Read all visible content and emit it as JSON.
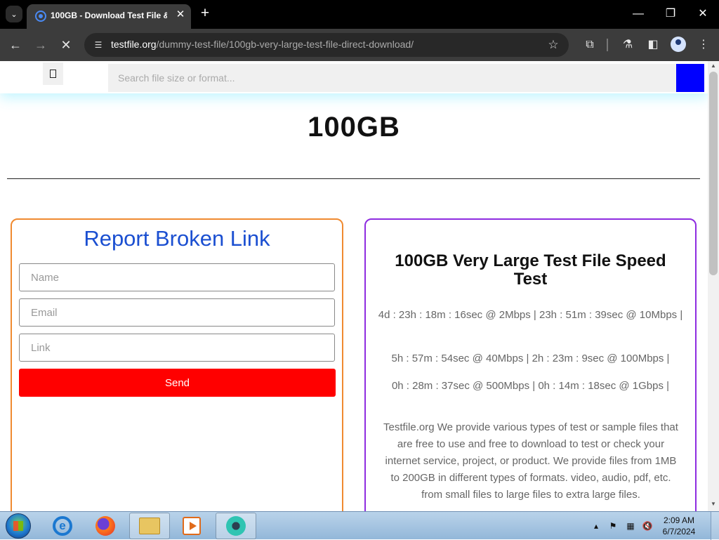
{
  "browser": {
    "tab_search_icon": "chevron-down",
    "tab_title": "100GB - Download Test File &",
    "tab_close": "✕",
    "new_tab": "+",
    "window_controls": {
      "minimize": "—",
      "restore": "❐",
      "close": "✕"
    },
    "url_domain": "testfile.org",
    "url_path": "/dummy-test-file/100gb-very-large-test-file-direct-download/",
    "icons": [
      "back-arrow",
      "forward-arrow",
      "stop-loading",
      "site-info",
      "bookmark-star",
      "extensions",
      "labs-flask",
      "side-panel",
      "profile",
      "kebab-menu"
    ]
  },
  "site_header": {
    "search_placeholder": "Search file size or format...",
    "search_button_color": "#0000ff"
  },
  "page": {
    "title": "100GB"
  },
  "report_form": {
    "title": "Report Broken Link",
    "name_placeholder": "Name",
    "email_placeholder": "Email",
    "link_placeholder": "Link",
    "send_label": "Send",
    "send_color": "#ff0000",
    "border_color": "#f08a30"
  },
  "speed_card": {
    "title": "100GB Very Large Test File Speed Test",
    "lines": [
      "4d : 23h : 18m : 16sec @ 2Mbps | 23h : 51m : 39sec @ 10Mbps |",
      "5h : 57m : 54sec @ 40Mbps | 2h : 23m : 9sec @ 100Mbps |",
      "0h : 28m : 37sec @ 500Mbps | 0h : 14m : 18sec @ 1Gbps |"
    ],
    "description": "Testfile.org We provide various types of test or sample files that are free to use and free to download to test or check your internet service, project, or product. We provide files from 1MB to 200GB in different types of formats. video, audio, pdf, etc. from small files to large files to extra large files.",
    "border_color": "#8e2ce0"
  },
  "taskbar": {
    "apps": [
      "internet-explorer",
      "firefox",
      "file-explorer",
      "media-player",
      "chrome-app"
    ],
    "time": "2:09 AM",
    "date": "6/7/2024",
    "tray_icons": [
      "show-hidden-icons",
      "action-center-flag",
      "network",
      "volume-muted"
    ]
  }
}
